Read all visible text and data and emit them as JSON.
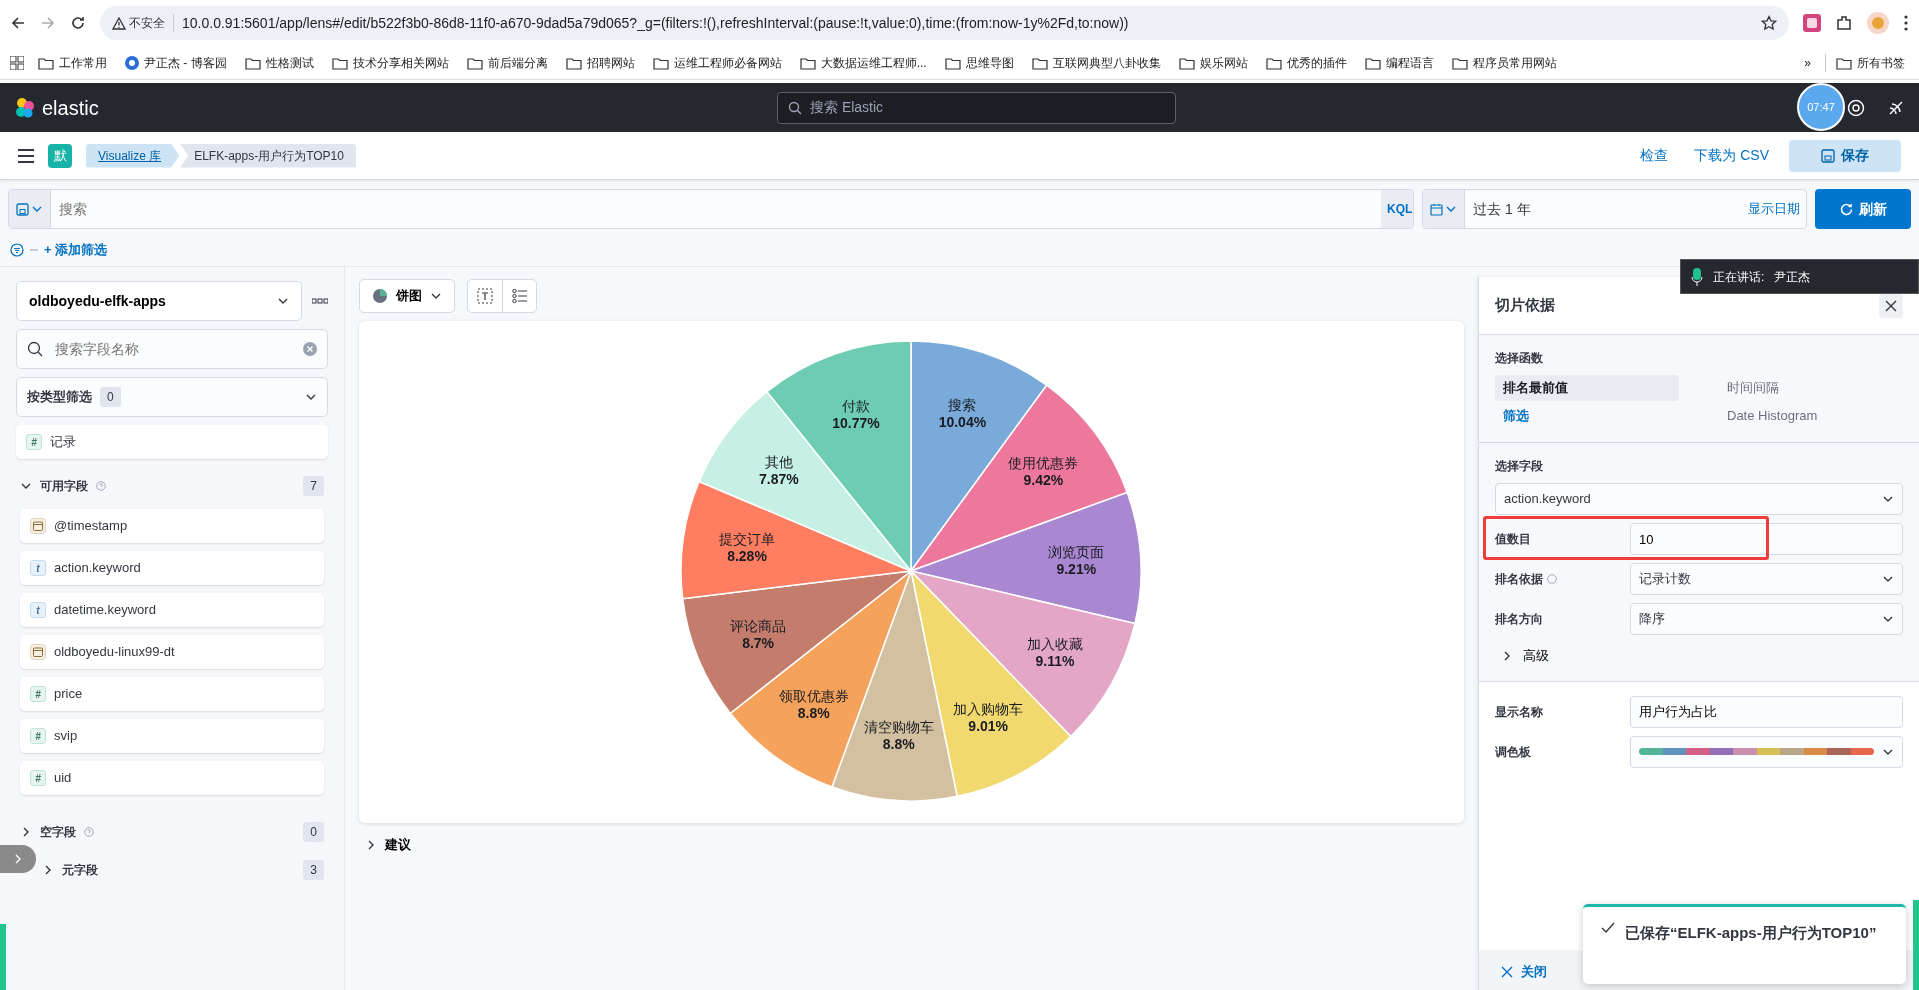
{
  "browser": {
    "security_label": "不安全",
    "url": "10.0.0.91:5601/app/lens#/edit/b522f3b0-86d8-11f0-a670-9dad5a79d065?_g=(filters:!(),refreshInterval:(pause:!t,value:0),time:(from:now-1y%2Fd,to:now))",
    "bookmarks": [
      {
        "label": "工作常用",
        "kind": "folder"
      },
      {
        "label": "尹正杰 - 博客园",
        "kind": "site"
      },
      {
        "label": "性格测试",
        "kind": "folder"
      },
      {
        "label": "技术分享相关网站",
        "kind": "folder"
      },
      {
        "label": "前后端分离",
        "kind": "folder"
      },
      {
        "label": "招聘网站",
        "kind": "folder"
      },
      {
        "label": "运维工程师必备网站",
        "kind": "folder"
      },
      {
        "label": "大数据运维工程师...",
        "kind": "folder"
      },
      {
        "label": "思维导图",
        "kind": "folder"
      },
      {
        "label": "互联网典型八卦收集",
        "kind": "folder"
      },
      {
        "label": "娱乐网站",
        "kind": "folder"
      },
      {
        "label": "优秀的插件",
        "kind": "folder"
      },
      {
        "label": "编程语言",
        "kind": "folder"
      },
      {
        "label": "程序员常用网站",
        "kind": "folder"
      }
    ],
    "overflow": "»",
    "all_bookmarks": "所有书签"
  },
  "header": {
    "brand": "elastic",
    "search_placeholder": "搜索 Elastic",
    "timer": "07:47"
  },
  "toolbar": {
    "avatar": "默",
    "breadcrumbs": [
      {
        "label": "Visualize 库",
        "link": true
      },
      {
        "label": "ELFK-apps-用户行为TOP10",
        "link": false
      }
    ],
    "actions": [
      "检查",
      "下载为 CSV"
    ],
    "save": "保存"
  },
  "query": {
    "placeholder": "搜索",
    "language": "KQL",
    "date_range": "过去 1 年",
    "show_dates": "显示日期",
    "refresh": "刷新",
    "add_filter": "+ 添加筛选"
  },
  "sidebar": {
    "index_pattern": "oldboyedu-elfk-apps",
    "field_search_placeholder": "搜索字段名称",
    "type_filter": {
      "label": "按类型筛选",
      "count": "0"
    },
    "records": {
      "label": "记录",
      "kind": "number",
      "glyph": "#"
    },
    "sections": [
      {
        "title": "可用字段",
        "expanded": true,
        "help": true,
        "count": "7",
        "fields": [
          {
            "label": "@timestamp",
            "kind": "date"
          },
          {
            "label": "action.keyword",
            "kind": "string",
            "glyph": "t"
          },
          {
            "label": "datetime.keyword",
            "kind": "string",
            "glyph": "t"
          },
          {
            "label": "oldboyedu-linux99-dt",
            "kind": "date"
          },
          {
            "label": "price",
            "kind": "number",
            "glyph": "#"
          },
          {
            "label": "svip",
            "kind": "number",
            "glyph": "#"
          },
          {
            "label": "uid",
            "kind": "number",
            "glyph": "#"
          }
        ]
      },
      {
        "title": "空字段",
        "expanded": false,
        "help": true,
        "count": "0"
      },
      {
        "title": "元字段",
        "expanded": false,
        "help": false,
        "count": "3"
      }
    ]
  },
  "workspace": {
    "chart_type": "饼图",
    "chart_data": {
      "type": "pie",
      "categories": [
        "搜索",
        "使用优惠券",
        "浏览页面",
        "加入收藏",
        "加入购物车",
        "清空购物车",
        "领取优惠券",
        "评论商品",
        "提交订单",
        "其他",
        "付款"
      ],
      "values": [
        10.04,
        9.42,
        9.21,
        9.11,
        9.01,
        8.8,
        8.8,
        8.7,
        8.28,
        7.87,
        10.77
      ],
      "colors": [
        "#79aad9",
        "#ee789d",
        "#a987d1",
        "#e4a6c7",
        "#f1d86f",
        "#d2c0a0",
        "#f5a35c",
        "#c47c6c",
        "#ff7e62",
        "#c5f0e3",
        "#6dccb1"
      ],
      "value_labels": [
        "10.04%",
        "9.42%",
        "9.21%",
        "9.11%",
        "9.01%",
        "8.8%",
        "8.8%",
        "8.7%",
        "8.28%",
        "7.87%",
        "10.77%"
      ]
    },
    "suggestions": {
      "label": "建议",
      "expanded": false
    }
  },
  "panel": {
    "title": "切片依据",
    "function_label": "选择函数",
    "functions": [
      {
        "label": "排名最前值",
        "selected": true,
        "disabled": false
      },
      {
        "label": "时间间隔",
        "selected": false,
        "disabled": true
      },
      {
        "label": "筛选",
        "selected": false,
        "disabled": false
      },
      {
        "label": "Date Histogram",
        "selected": false,
        "disabled": true
      }
    ],
    "field_label": "选择字段",
    "field": "action.keyword",
    "settings": [
      {
        "label": "值数目",
        "value": "10",
        "kind": "input",
        "help": false
      },
      {
        "label": "排名依据",
        "value": "记录计数",
        "kind": "select",
        "help": true
      },
      {
        "label": "排名方向",
        "value": "降序",
        "kind": "select",
        "help": false
      }
    ],
    "advanced": {
      "label": "高级",
      "expanded": false
    },
    "display": [
      {
        "label": "显示名称",
        "value": "用户行为占比",
        "kind": "input"
      },
      {
        "label": "调色板",
        "kind": "palette"
      }
    ],
    "palette": [
      {
        "color": "#54b399"
      },
      {
        "color": "#6092c0"
      },
      {
        "color": "#d36086"
      },
      {
        "color": "#9170b8"
      },
      {
        "color": "#ca8eae"
      },
      {
        "color": "#d6bf57"
      },
      {
        "color": "#b9a888"
      },
      {
        "color": "#da8b45"
      },
      {
        "color": "#aa6556"
      },
      {
        "color": "#e7664c"
      }
    ],
    "close": "关闭"
  },
  "overlays": {
    "speaker": {
      "label": "正在讲话:",
      "name": "尹正杰"
    },
    "toast": {
      "message": "已保存“ELFK-apps-用户行为TOP10”"
    }
  }
}
